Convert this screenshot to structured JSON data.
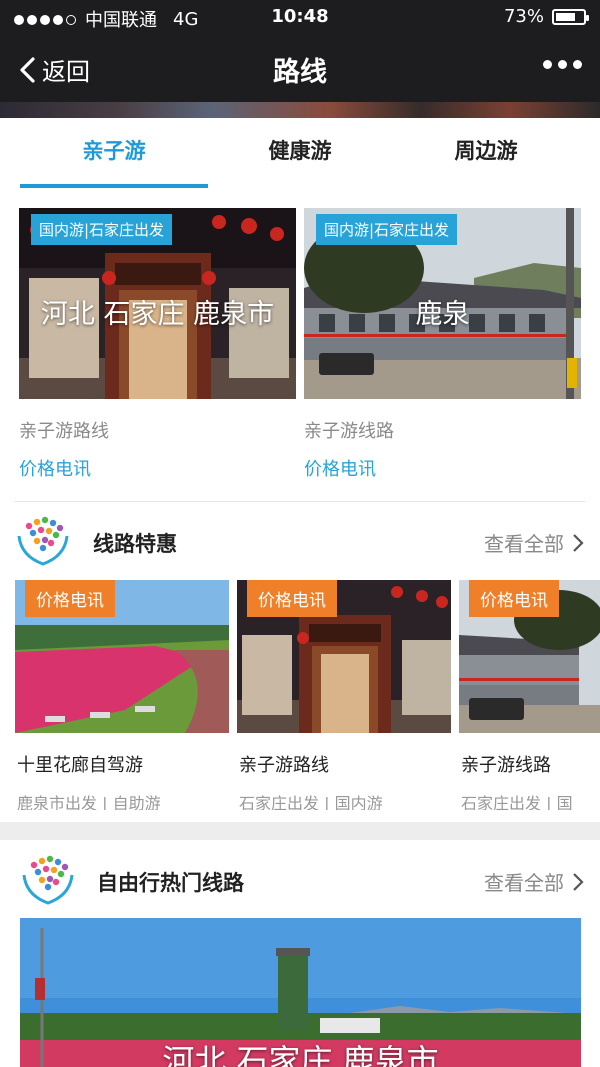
{
  "status_bar": {
    "carrier": "中国联通",
    "network": "4G",
    "time": "10:48",
    "battery": "73%",
    "battery_level": 0.73
  },
  "nav": {
    "back_label": "返回",
    "title": "路线"
  },
  "tabs": [
    {
      "label": "亲子游",
      "active": true
    },
    {
      "label": "健康游",
      "active": false
    },
    {
      "label": "周边游",
      "active": false
    }
  ],
  "route_cards": [
    {
      "tag": "国内游|石家庄出发",
      "caption": "河北 石家庄 鹿泉市",
      "name": "亲子游路线",
      "price": "价格电讯"
    },
    {
      "tag": "国内游|石家庄出发",
      "caption": "鹿泉",
      "name": "亲子游线路",
      "price": "价格电讯"
    }
  ],
  "deals_section": {
    "title": "线路特惠",
    "view_all": "查看全部"
  },
  "deals": [
    {
      "price_tag": "价格电讯",
      "title": "十里花廊自驾游",
      "subtitle": "鹿泉市出发 | 自助游"
    },
    {
      "price_tag": "价格电讯",
      "title": "亲子游路线",
      "subtitle": "石家庄出发 | 国内游"
    },
    {
      "price_tag": "价格电讯",
      "title": "亲子游线路",
      "subtitle": "石家庄出发 | 国"
    }
  ],
  "free_section": {
    "title": "自由行热门线路",
    "view_all": "查看全部",
    "image_caption": "河北 石家庄 鹿泉市"
  },
  "colors": {
    "accent_blue": "#1e9bd7",
    "price_orange": "#f07f2a",
    "tag_blue": "#27a3d8",
    "navbar_dark": "#1d1d1f"
  }
}
